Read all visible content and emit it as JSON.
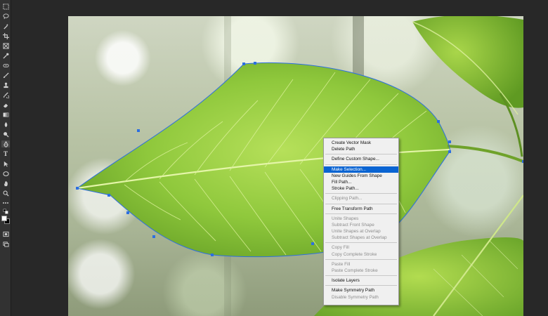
{
  "toolbar": {
    "tools": [
      {
        "name": "marquee-tool-icon"
      },
      {
        "name": "lasso-tool-icon"
      },
      {
        "name": "magic-wand-tool-icon"
      },
      {
        "name": "crop-tool-icon"
      },
      {
        "name": "frame-tool-icon"
      },
      {
        "name": "eyedropper-tool-icon"
      },
      {
        "name": "healing-brush-tool-icon"
      },
      {
        "name": "brush-tool-icon"
      },
      {
        "name": "clone-stamp-tool-icon"
      },
      {
        "name": "history-brush-tool-icon"
      },
      {
        "name": "eraser-tool-icon"
      },
      {
        "name": "gradient-tool-icon"
      },
      {
        "name": "blur-tool-icon"
      },
      {
        "name": "dodge-tool-icon"
      },
      {
        "name": "pen-tool-icon"
      },
      {
        "name": "type-tool-icon"
      },
      {
        "name": "path-selection-tool-icon"
      },
      {
        "name": "shape-tool-icon"
      },
      {
        "name": "hand-tool-icon"
      },
      {
        "name": "zoom-tool-icon"
      }
    ],
    "type_tool_glyph": "T",
    "foreground_color": "#ffffff",
    "background_color": "#000000"
  },
  "context_menu": {
    "groups": [
      {
        "items": [
          {
            "label": "Create Vector Mask",
            "enabled": true
          },
          {
            "label": "Delete Path",
            "enabled": true
          }
        ]
      },
      {
        "items": [
          {
            "label": "Define Custom Shape...",
            "enabled": true
          }
        ]
      },
      {
        "items": [
          {
            "label": "Make Selection...",
            "enabled": true,
            "highlighted": true
          },
          {
            "label": "New Guides From Shape",
            "enabled": true
          },
          {
            "label": "Fill Path...",
            "enabled": true
          },
          {
            "label": "Stroke Path...",
            "enabled": true
          }
        ]
      },
      {
        "items": [
          {
            "label": "Clipping Path...",
            "enabled": false
          }
        ]
      },
      {
        "items": [
          {
            "label": "Free Transform Path",
            "enabled": true
          }
        ]
      },
      {
        "items": [
          {
            "label": "Unite Shapes",
            "enabled": false
          },
          {
            "label": "Subtract Front Shape",
            "enabled": false
          },
          {
            "label": "Unite Shapes at Overlap",
            "enabled": false
          },
          {
            "label": "Subtract Shapes at Overlap",
            "enabled": false
          }
        ]
      },
      {
        "items": [
          {
            "label": "Copy Fill",
            "enabled": false
          },
          {
            "label": "Copy Complete Stroke",
            "enabled": false
          }
        ]
      },
      {
        "items": [
          {
            "label": "Paste Fill",
            "enabled": false
          },
          {
            "label": "Paste Complete Stroke",
            "enabled": false
          }
        ]
      },
      {
        "items": [
          {
            "label": "Isolate Layers",
            "enabled": true
          }
        ]
      },
      {
        "items": [
          {
            "label": "Make Symmetry Path",
            "enabled": true
          },
          {
            "label": "Disable Symmetry Path",
            "enabled": false
          }
        ]
      }
    ]
  },
  "colors": {
    "highlight": "#0a64d2",
    "path_stroke": "#2d6fe0",
    "leaf_main": "#8dc63f",
    "leaf_dark": "#5e9a1f"
  }
}
